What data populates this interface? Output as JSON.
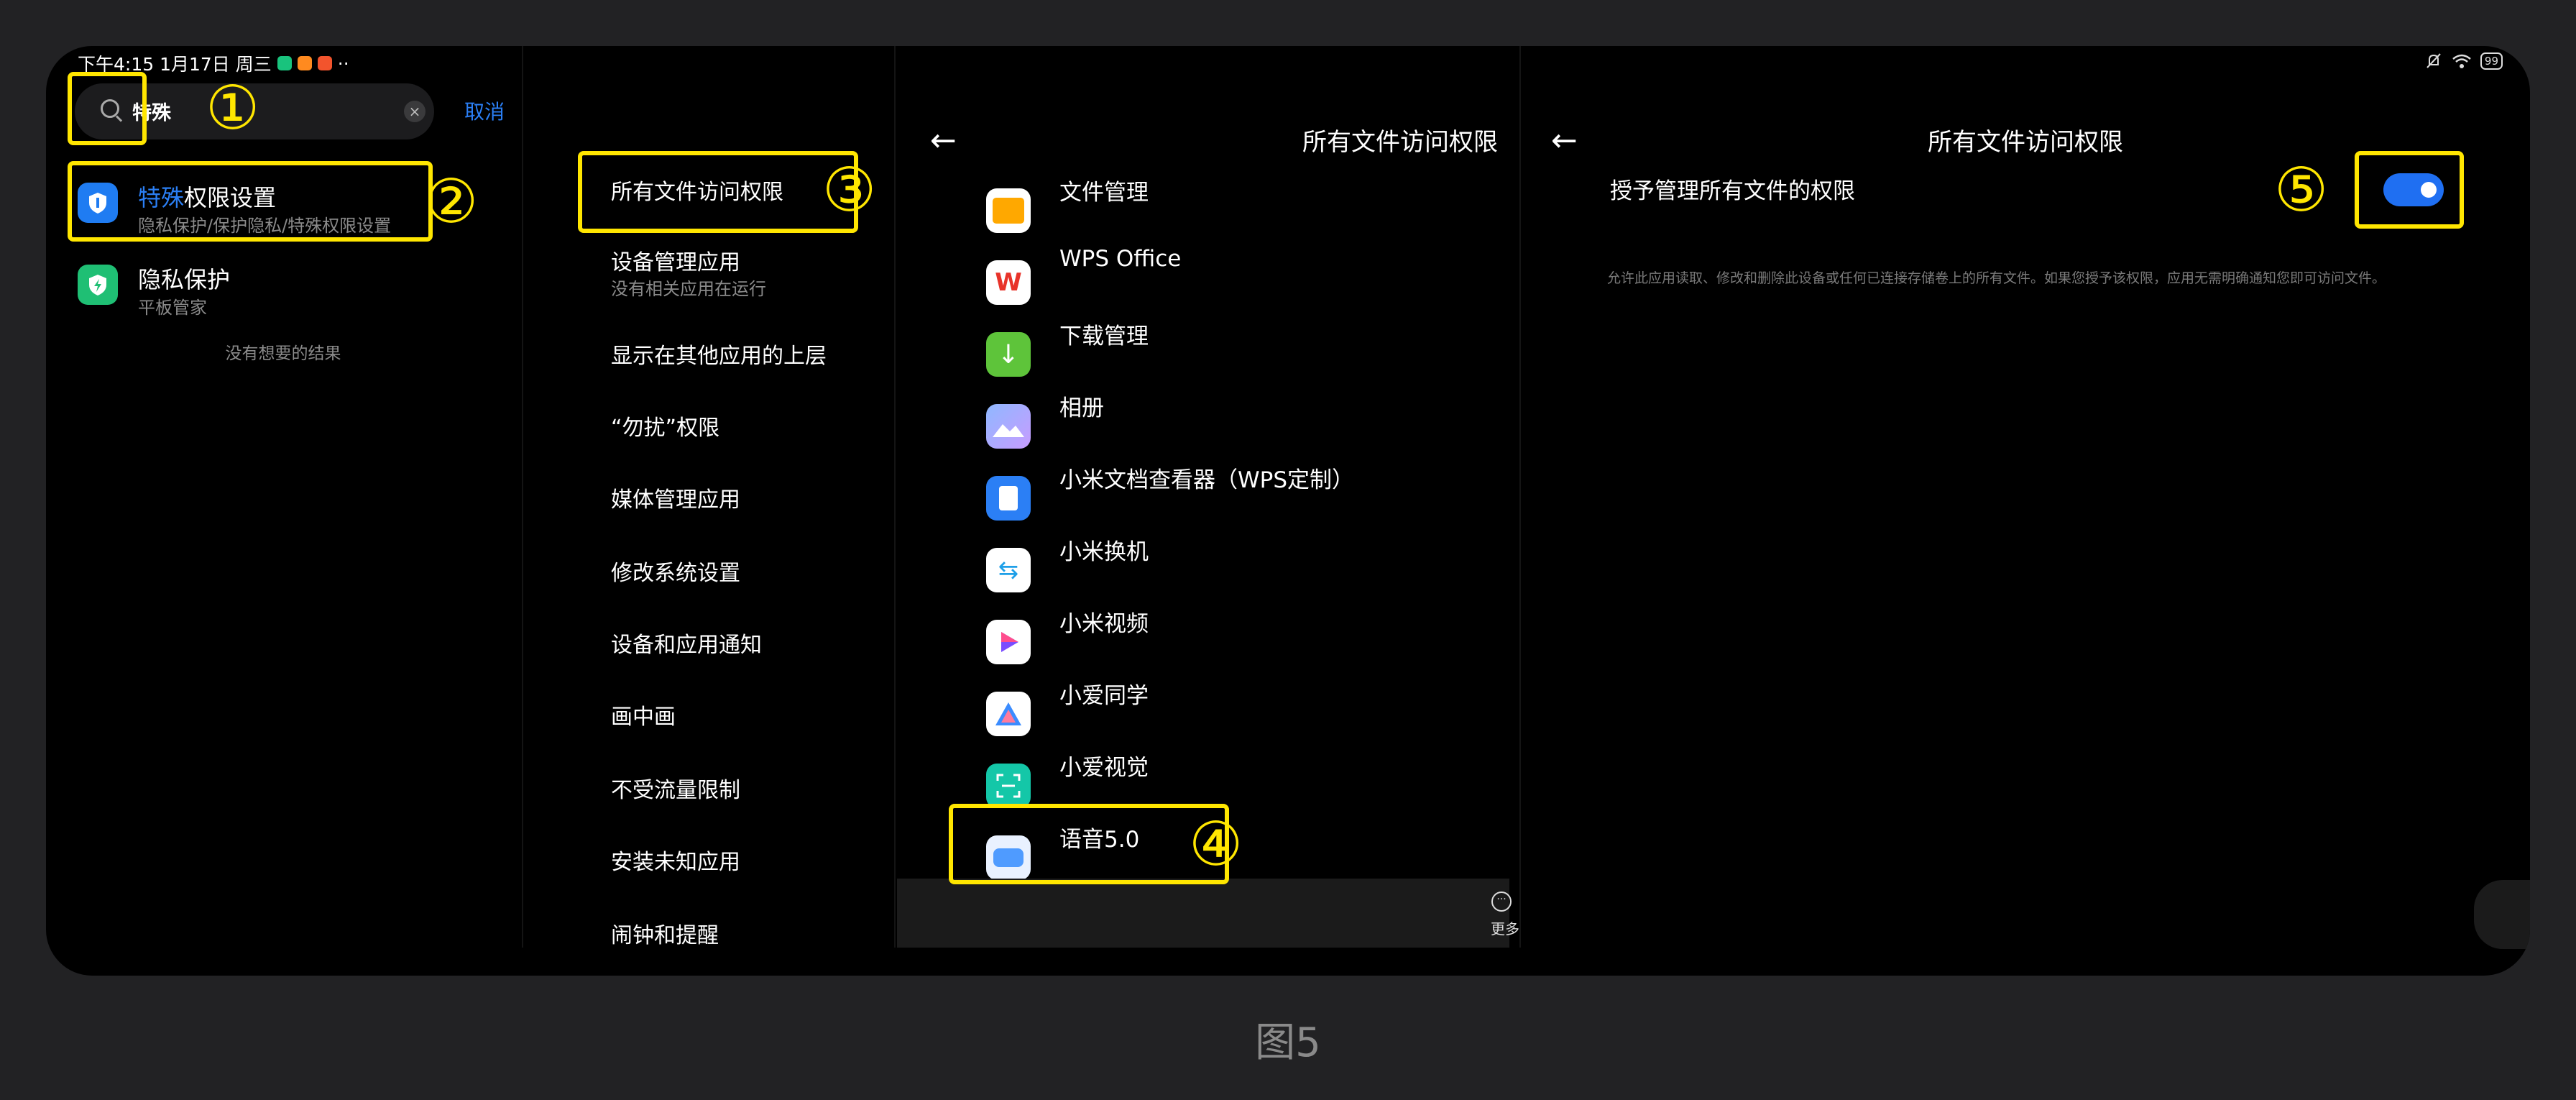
{
  "status_bar": {
    "time": "下午4:15 1月17日 周三",
    "more": "··",
    "battery": "99"
  },
  "search": {
    "query": "特殊",
    "cancel": "取消"
  },
  "results": [
    {
      "title_highlight": "特殊",
      "title_rest": "权限设置",
      "subtitle": "隐私保护/保护隐私/特殊权限设置"
    },
    {
      "title": "隐私保护",
      "subtitle": "平板管家"
    }
  ],
  "no_result": "没有想要的结果",
  "special_permissions": {
    "items": [
      {
        "label": "所有文件访问权限"
      },
      {
        "label": "设备管理应用",
        "subtitle": "没有相关应用在运行"
      },
      {
        "label": "显示在其他应用的上层"
      },
      {
        "label": "“勿扰”权限"
      },
      {
        "label": "媒体管理应用"
      },
      {
        "label": "修改系统设置"
      },
      {
        "label": "设备和应用通知"
      },
      {
        "label": "画中画"
      },
      {
        "label": "不受流量限制"
      },
      {
        "label": "安装未知应用"
      },
      {
        "label": "闹钟和提醒"
      }
    ]
  },
  "app_list": {
    "back": "←",
    "title": "所有文件访问权限",
    "apps": [
      "文件管理",
      "WPS Office",
      "下载管理",
      "相册",
      "小米文档查看器（WPS定制）",
      "小米换机",
      "小米视频",
      "小爱同学",
      "小爱视觉",
      "语音5.0"
    ],
    "more": "更多"
  },
  "detail": {
    "back": "←",
    "title": "所有文件访问权限",
    "setting_label": "授予管理所有文件的权限",
    "toggle_on": true,
    "description": "允许此应用读取、修改和删除此设备或任何已连接存储卷上的所有文件。如果您授予该权限，应用无需明确通知您即可访问文件。"
  },
  "annotations": [
    "①",
    "②",
    "③",
    "④",
    "⑤"
  ],
  "caption": "图5",
  "colors": {
    "accent": "#2b7ff5",
    "annotation": "#ffe600",
    "toggle": "#1f6ff2"
  }
}
